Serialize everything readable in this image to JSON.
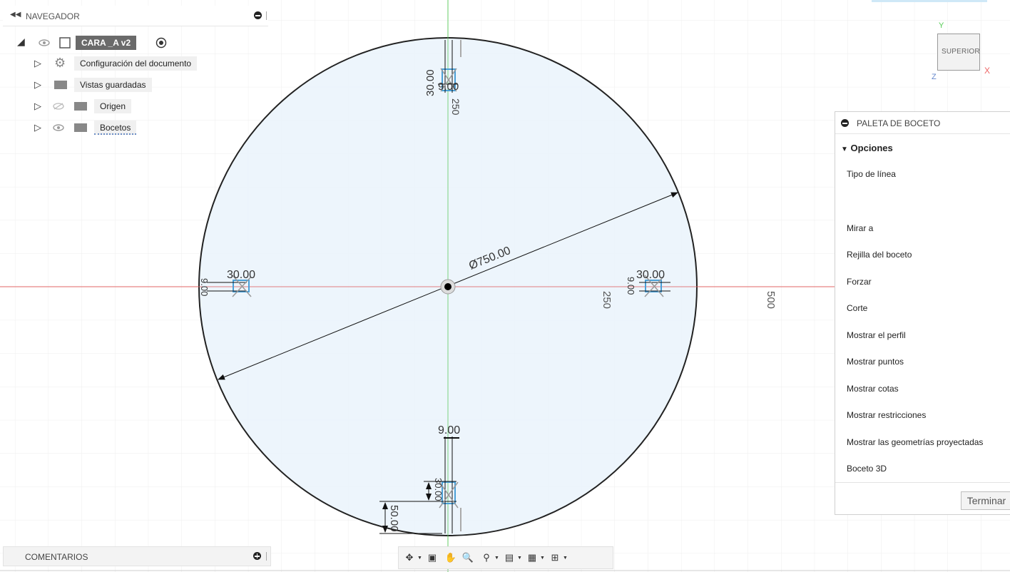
{
  "navigator": {
    "title": "NAVEGADOR",
    "document": "CARA _A v2",
    "items": [
      {
        "label": "Configuración del documento",
        "icon": "gear-icon"
      },
      {
        "label": "Vistas guardadas",
        "icon": "folder-icon"
      },
      {
        "label": "Origen",
        "icon": "folder-icon"
      },
      {
        "label": "Bocetos",
        "icon": "folder-icon"
      }
    ]
  },
  "comments": {
    "title": "COMENTARIOS"
  },
  "palette": {
    "title": "PALETA DE BOCETO",
    "section": "Opciones",
    "options": [
      "Tipo de línea",
      "Mirar a",
      "Rejilla del boceto",
      "Forzar",
      "Corte",
      "Mostrar el perfil",
      "Mostrar puntos",
      "Mostrar cotas",
      "Mostrar restricciones",
      "Mostrar las geometrías proyectadas",
      "Boceto 3D"
    ],
    "finish": "Terminar"
  },
  "viewcube": {
    "face": "SUPERIOR",
    "axis_x": "X",
    "axis_y": "Y",
    "axis_z": "Z"
  },
  "sketch": {
    "diameter": "Ø750.00",
    "ruler_250": "250",
    "ruler_500": "500",
    "dim_top_1": "30.00",
    "dim_top_2": "9.00",
    "dim_top_3": "250",
    "dim_left_1": "30.00",
    "dim_left_2": "9.00",
    "dim_right_1": "30.00",
    "dim_right_2": "9.00",
    "dim_bottom_1": "9.00",
    "dim_bottom_2": "30.00",
    "dim_bottom_3": "50.00"
  },
  "colors": {
    "sketch_fill": "#eaf3fb",
    "x_axis": "#e06666",
    "y_axis": "#66cc66",
    "grid": "#e4e4e4",
    "dimension": "#111111"
  }
}
